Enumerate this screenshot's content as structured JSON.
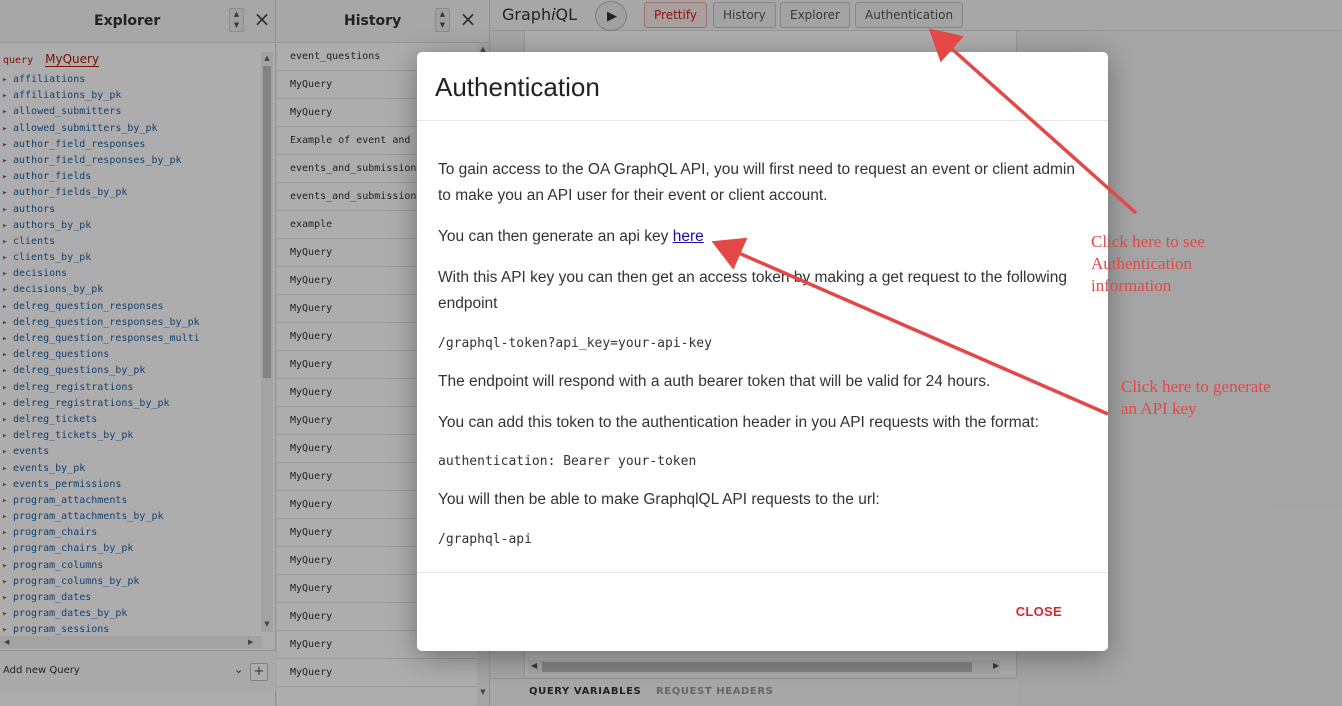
{
  "explorer": {
    "title": "Explorer",
    "query_keyword": "query",
    "query_name": "MyQuery",
    "fields": [
      "affiliations",
      "affiliations_by_pk",
      "allowed_submitters",
      "allowed_submitters_by_pk",
      "author_field_responses",
      "author_field_responses_by_pk",
      "author_fields",
      "author_fields_by_pk",
      "authors",
      "authors_by_pk",
      "clients",
      "clients_by_pk",
      "decisions",
      "decisions_by_pk",
      "delreg_question_responses",
      "delreg_question_responses_by_pk",
      "delreg_question_responses_multi",
      "delreg_questions",
      "delreg_questions_by_pk",
      "delreg_registrations",
      "delreg_registrations_by_pk",
      "delreg_tickets",
      "delreg_tickets_by_pk",
      "events",
      "events_by_pk",
      "events_permissions",
      "program_attachments",
      "program_attachments_by_pk",
      "program_chairs",
      "program_chairs_by_pk",
      "program_columns",
      "program_columns_by_pk",
      "program_dates",
      "program_dates_by_pk",
      "program_sessions"
    ],
    "add_query_label": "Add new Query",
    "add_button": "+"
  },
  "history": {
    "title": "History",
    "items": [
      "event_questions",
      "MyQuery",
      "MyQuery",
      "Example of event and questions",
      "events_and_submissions",
      "events_and_submissions",
      "example",
      "MyQuery",
      "MyQuery",
      "MyQuery",
      "MyQuery",
      "MyQuery",
      "MyQuery",
      "MyQuery",
      "MyQuery",
      "MyQuery",
      "MyQuery",
      "MyQuery",
      "MyQuery",
      "MyQuery",
      "MyQuery",
      "MyQuery",
      "MyQuery"
    ]
  },
  "toolbar": {
    "brand_prefix": "Graph",
    "brand_i": "i",
    "brand_suffix": "QL",
    "prettify": "Prettify",
    "history": "History",
    "explorer": "Explorer",
    "authentication": "Authentication"
  },
  "editor": {
    "tab_query_variables": "QUERY VARIABLES",
    "tab_request_headers": "REQUEST HEADERS"
  },
  "dialog": {
    "title": "Authentication",
    "p1": "To gain access to the OA GraphQL API, you will first need to request an event or client admin to make you an API user for their event or client account.",
    "p2_prefix": "You can then generate an api key ",
    "p2_link": "here",
    "p3": "With this API key you can then get an access token by making a get request to the following endpoint",
    "code1": "/graphql-token?api_key=your-api-key",
    "p4": "The endpoint will respond with a auth bearer token that will be valid for 24 hours.",
    "p5": "You can add this token to the authentication header in you API requests with the format:",
    "code2": "authentication: Bearer your-token",
    "p6": "You will then be able to make GraphqlQL API requests to the url:",
    "code3": "/graphql-api",
    "close": "CLOSE"
  },
  "annotations": {
    "auth_note": "Click here to see Authentication information",
    "key_note": "Click here to generate an API key",
    "color": "#e34846"
  },
  "colors": {
    "accent_red": "#d7282f",
    "link": "#1a0dab",
    "field_blue": "#1f61a0"
  }
}
